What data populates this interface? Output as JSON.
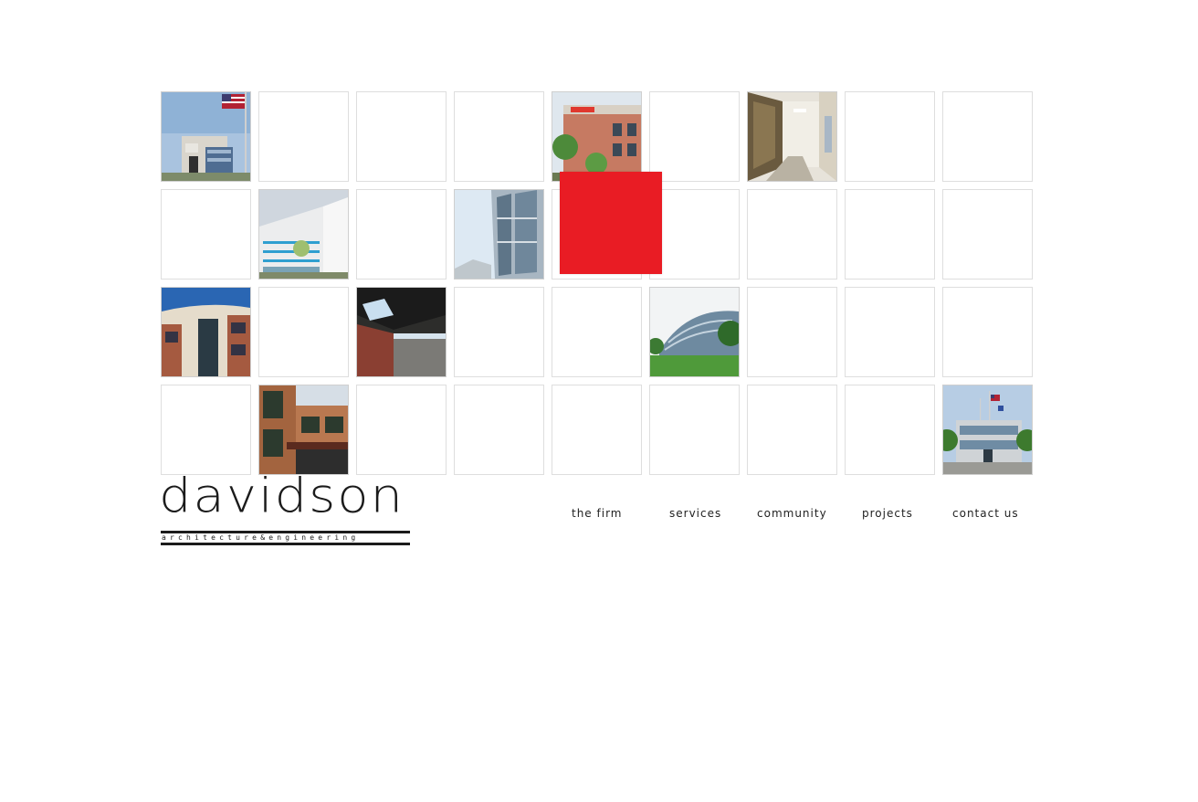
{
  "logo": {
    "name": "davidson",
    "tagline": "architecture&engineering"
  },
  "nav": {
    "items": [
      {
        "label": "the firm"
      },
      {
        "label": "services"
      },
      {
        "label": "community"
      },
      {
        "label": "projects"
      },
      {
        "label": "contact us"
      }
    ]
  },
  "colors": {
    "accent": "#e91c24",
    "tile_border": "#dedede",
    "text": "#222222"
  },
  "grid": {
    "rows": 4,
    "cols": 9,
    "photo_tiles": [
      {
        "row": 0,
        "col": 0,
        "subject": "flag-office-building"
      },
      {
        "row": 0,
        "col": 4,
        "subject": "brick-retail-building"
      },
      {
        "row": 0,
        "col": 6,
        "subject": "interior-corridor"
      },
      {
        "row": 1,
        "col": 1,
        "subject": "white-office-building"
      },
      {
        "row": 1,
        "col": 3,
        "subject": "glass-tower"
      },
      {
        "row": 2,
        "col": 0,
        "subject": "curved-brick-building"
      },
      {
        "row": 2,
        "col": 2,
        "subject": "interior-ceiling"
      },
      {
        "row": 2,
        "col": 5,
        "subject": "glass-curved-building"
      },
      {
        "row": 3,
        "col": 1,
        "subject": "brick-office-entrance"
      },
      {
        "row": 3,
        "col": 8,
        "subject": "office-campus-flags"
      }
    ]
  }
}
